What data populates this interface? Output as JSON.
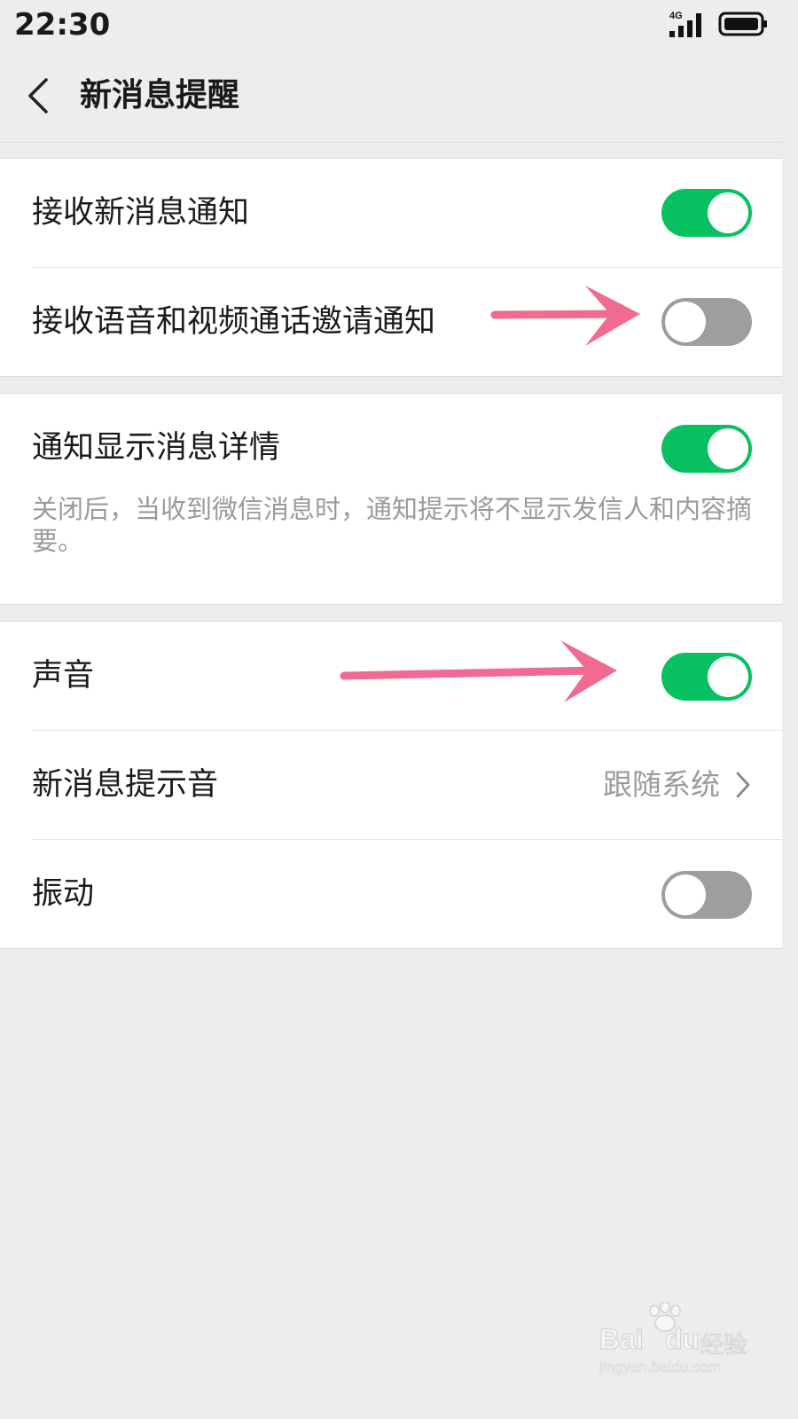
{
  "status_bar": {
    "time": "22:30",
    "network": "4G"
  },
  "header": {
    "title": "新消息提醒"
  },
  "groups": [
    {
      "rows": [
        {
          "label": "接收新消息通知",
          "toggle": "on"
        },
        {
          "label": "接收语音和视频通话邀请通知",
          "toggle": "off"
        }
      ]
    },
    {
      "rows": [
        {
          "label": "通知显示消息详情",
          "toggle": "on",
          "description": "关闭后，当收到微信消息时，通知提示将不显示发信人和内容摘要。"
        }
      ]
    },
    {
      "rows": [
        {
          "label": "声音",
          "toggle": "on"
        },
        {
          "label": "新消息提示音",
          "value": "跟随系统"
        },
        {
          "label": "振动",
          "toggle": "off"
        }
      ]
    }
  ],
  "watermark": {
    "brand_left": "Bai",
    "brand_right": "du",
    "cn": "经验",
    "url": "jingyan.baidu.com"
  },
  "colors": {
    "toggle_on": "#07c160",
    "toggle_off": "#9e9e9e",
    "annotation_arrow": "#f06a91",
    "background": "#ededed"
  }
}
